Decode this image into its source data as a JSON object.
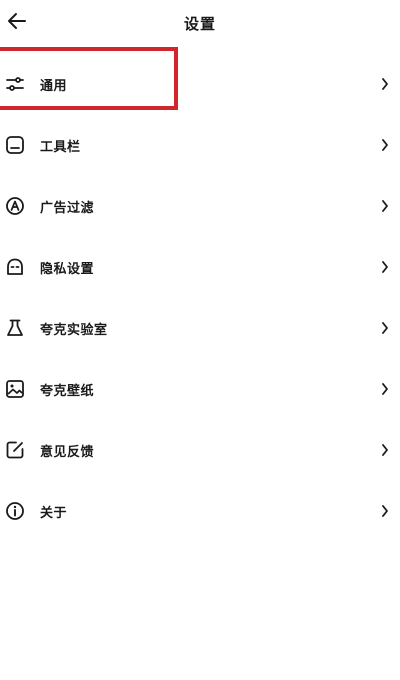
{
  "header": {
    "title": "设置",
    "back_icon": "arrow-left-icon"
  },
  "menu": {
    "items": [
      {
        "label": "通用",
        "icon": "sliders-icon"
      },
      {
        "label": "工具栏",
        "icon": "toolbar-icon"
      },
      {
        "label": "广告过滤",
        "icon": "ad-filter-icon"
      },
      {
        "label": "隐私设置",
        "icon": "privacy-mask-icon"
      },
      {
        "label": "夸克实验室",
        "icon": "flask-icon"
      },
      {
        "label": "夸克壁纸",
        "icon": "wallpaper-image-icon"
      },
      {
        "label": "意见反馈",
        "icon": "edit-feedback-icon"
      },
      {
        "label": "关于",
        "icon": "info-icon"
      }
    ],
    "chevron_icon": "chevron-right-icon"
  },
  "annotation": {
    "highlight_color": "#d0262c"
  }
}
